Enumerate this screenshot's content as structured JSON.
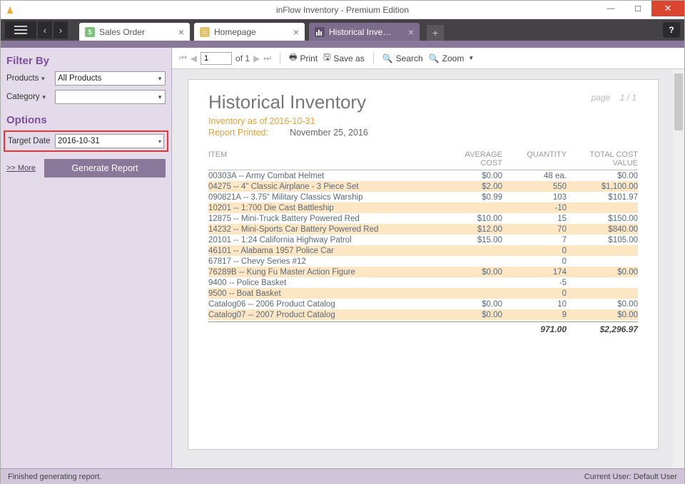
{
  "window": {
    "title": "inFlow Inventory - Premium Edition"
  },
  "tabs": [
    {
      "label": "Sales Order"
    },
    {
      "label": "Homepage"
    },
    {
      "label": "Historical Inve…"
    }
  ],
  "sidebar": {
    "filterby_title": "Filter By",
    "products_label": "Products",
    "products_value": "All Products",
    "category_label": "Category",
    "category_value": "",
    "options_title": "Options",
    "targetdate_label": "Target Date",
    "targetdate_value": "2016-10-31",
    "more_label": ">> More",
    "generate_label": "Generate Report"
  },
  "toolbar": {
    "page_value": "1",
    "page_of": "of  1",
    "print": "Print",
    "saveas": "Save as",
    "search": "Search",
    "zoom": "Zoom"
  },
  "report": {
    "pageindicator_label": "page",
    "pageindicator_value": "1 /  1",
    "title": "Historical Inventory",
    "asof": "Inventory as of 2016-10-31",
    "printed_label": "Report Printed:",
    "printed_value": "November 25, 2016",
    "headers": {
      "item": "ITEM",
      "avg1": "AVERAGE",
      "avg2": "COST",
      "qty": "QUANTITY",
      "tot1": "TOTAL COST",
      "tot2": "VALUE"
    },
    "rows": [
      {
        "item": "00303A -- Army Combat Helmet",
        "avg": "$0.00",
        "qty": "48 ea.",
        "tot": "$0.00",
        "alt": false
      },
      {
        "item": "04275 -- 4\" Classic Airplane - 3 Piece Set",
        "avg": "$2.00",
        "qty": "550",
        "tot": "$1,100.00",
        "alt": true
      },
      {
        "item": "090821A -- 3.75\" Military Classics Warship",
        "avg": "$0.99",
        "qty": "103",
        "tot": "$101.97",
        "alt": false
      },
      {
        "item": "10201 -- 1:700 Die Cast Battleship",
        "avg": "",
        "qty": "-10",
        "tot": "",
        "alt": true
      },
      {
        "item": "12875 -- Mini-Truck Battery Powered Red",
        "avg": "$10.00",
        "qty": "15",
        "tot": "$150.00",
        "alt": false
      },
      {
        "item": "14232 -- Mini-Sports Car Battery Powered Red",
        "avg": "$12.00",
        "qty": "70",
        "tot": "$840.00",
        "alt": true
      },
      {
        "item": "20101 -- 1:24 California Highway Patrol",
        "avg": "$15.00",
        "qty": "7",
        "tot": "$105.00",
        "alt": false
      },
      {
        "item": "46101 -- Alabama 1957 Police Car",
        "avg": "",
        "qty": "0",
        "tot": "",
        "alt": true
      },
      {
        "item": "67817 -- Chevy Series #12",
        "avg": "",
        "qty": "0",
        "tot": "",
        "alt": false
      },
      {
        "item": "76289B -- Kung Fu Master Action Figure",
        "avg": "$0.00",
        "qty": "174",
        "tot": "$0.00",
        "alt": true
      },
      {
        "item": "9400 -- Police Basket",
        "avg": "",
        "qty": "-5",
        "tot": "",
        "alt": false
      },
      {
        "item": "9500 -- Boat Basket",
        "avg": "",
        "qty": "0",
        "tot": "",
        "alt": true
      },
      {
        "item": "Catalog06 -- 2006 Product Catalog",
        "avg": "$0.00",
        "qty": "10",
        "tot": "$0.00",
        "alt": false
      },
      {
        "item": "Catalog07 -- 2007 Product Catalog",
        "avg": "$0.00",
        "qty": "9",
        "tot": "$0.00",
        "alt": true
      }
    ],
    "totals": {
      "qty": "971.00",
      "tot": "$2,296.97"
    }
  },
  "status": {
    "left": "Finished generating report.",
    "right": "Current User:  Default User"
  }
}
